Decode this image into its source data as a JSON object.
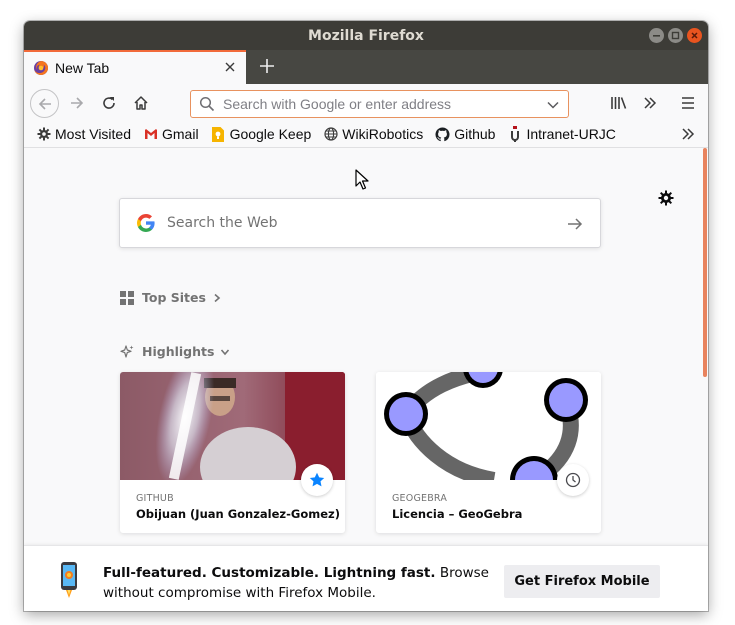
{
  "window": {
    "title": "Mozilla Firefox"
  },
  "tabs": [
    {
      "label": "New Tab"
    }
  ],
  "navbar": {
    "url_placeholder": "Search with Google or enter address"
  },
  "bookmarks": [
    {
      "label": "Most Visited",
      "icon": "gear-icon"
    },
    {
      "label": "Gmail",
      "icon": "gmail-icon"
    },
    {
      "label": "Google Keep",
      "icon": "keep-icon"
    },
    {
      "label": "WikiRobotics",
      "icon": "globe-icon"
    },
    {
      "label": "Github",
      "icon": "github-icon"
    },
    {
      "label": "Intranet-URJC",
      "icon": "urjc-icon"
    }
  ],
  "newtab": {
    "search_placeholder": "Search the Web",
    "top_sites_label": "Top Sites",
    "highlights_label": "Highlights",
    "cards": [
      {
        "source": "GITHUB",
        "title": "Obijuan (Juan Gonzalez-Gomez)",
        "badge": "bookmark-star-icon"
      },
      {
        "source": "GEOGEBRA",
        "title": "Licencia – GeoGebra",
        "badge": "history-clock-icon"
      }
    ],
    "mobile_promo": {
      "bold": "Full-featured. Customizable. Lightning fast.",
      "rest": " Browse without compromise with Firefox Mobile.",
      "button": "Get Firefox Mobile"
    }
  },
  "colors": {
    "accent": "#f26a3a",
    "titlebar": "#3d3c37",
    "tabstrip": "#474742",
    "urlbar_border": "#e8925f",
    "close_button": "#e9541f",
    "geogebra_node": "#9999ff"
  }
}
